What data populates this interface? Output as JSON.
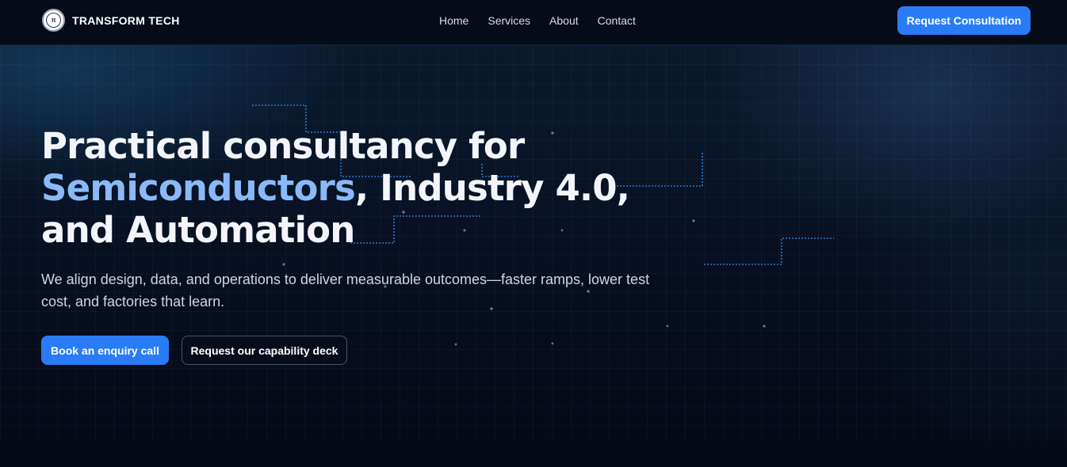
{
  "header": {
    "brand": "TRANSFORM TECH",
    "logo_glyph": "π",
    "nav": [
      "Home",
      "Services",
      "About",
      "Contact"
    ],
    "cta_label": "Request Consultation"
  },
  "hero": {
    "headline_line1": "Practical consultancy for",
    "headline_accent": "Semiconductors",
    "headline_line2_rest": ", Industry 4.0,",
    "headline_line3": "and Automation",
    "subtext": "We align design, data, and operations to deliver measurable outcomes—faster ramps, lower test cost, and factories that learn.",
    "primary_button": "Book an enquiry call",
    "secondary_button": "Request our capability deck"
  },
  "colors": {
    "accent": "#2a7cf6",
    "headline_accent": "#8ab9f7",
    "background": "#050a17",
    "circuit_line": "#2f84e8"
  },
  "icons": {
    "logo": "brand-seal-icon"
  }
}
